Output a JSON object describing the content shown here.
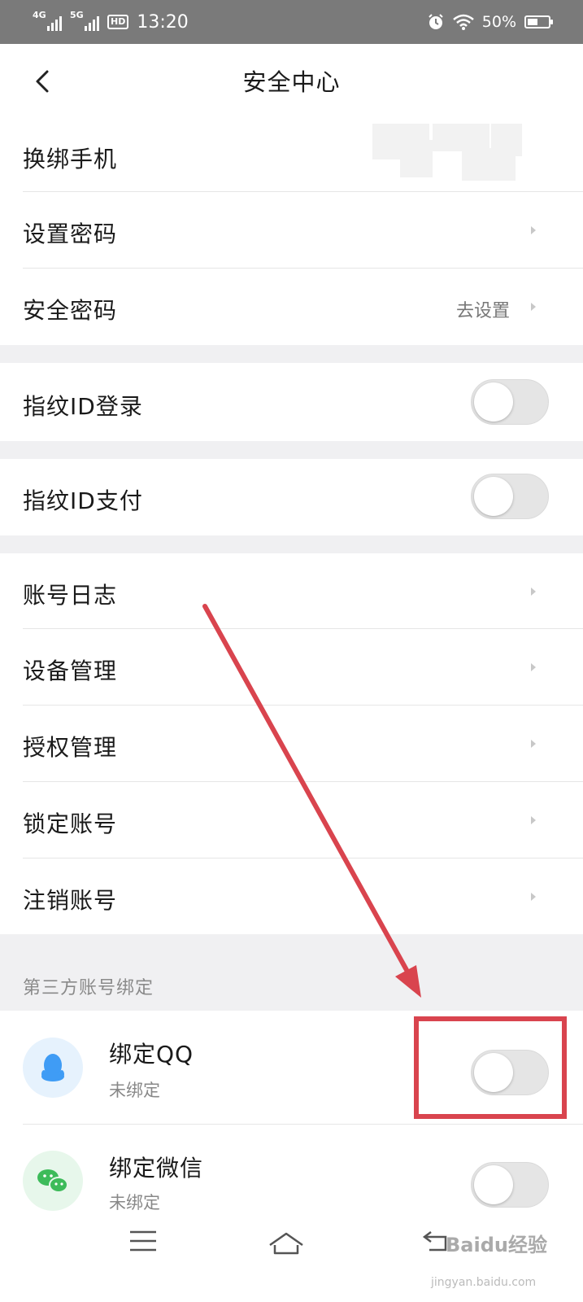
{
  "status_bar": {
    "signal_1_label": "4G",
    "signal_2_label": "5G",
    "hd_label": "HD",
    "time": "13:20",
    "battery_percent": "50%",
    "battery_level": 0.5,
    "icons": [
      "alarm-icon",
      "wifi-icon",
      "battery-icon"
    ]
  },
  "header": {
    "title": "安全中心"
  },
  "account_section": {
    "items": [
      {
        "label": "换绑手机",
        "value": ""
      },
      {
        "label": "设置密码",
        "value": ""
      },
      {
        "label": "安全密码",
        "value": "去设置"
      }
    ]
  },
  "toggles": {
    "fingerprint_login": {
      "label": "指纹ID登录",
      "on": false
    },
    "fingerprint_pay": {
      "label": "指纹ID支付",
      "on": false
    }
  },
  "manage_section": {
    "items": [
      {
        "label": "账号日志"
      },
      {
        "label": "设备管理"
      },
      {
        "label": "授权管理"
      },
      {
        "label": "锁定账号"
      },
      {
        "label": "注销账号"
      }
    ]
  },
  "third_party": {
    "section_title": "第三方账号绑定",
    "items": [
      {
        "title": "绑定QQ",
        "status": "未绑定",
        "on": false,
        "icon": "qq-icon"
      },
      {
        "title": "绑定微信",
        "status": "未绑定",
        "on": false,
        "icon": "wechat-icon"
      }
    ]
  },
  "colors": {
    "accent_annotation": "#d9444e",
    "qq_blue": "#3f9cf5",
    "wechat_green": "#3dbb5a"
  },
  "watermark": {
    "text": "Baidu经验",
    "sub": "jingyan.baidu.com"
  }
}
